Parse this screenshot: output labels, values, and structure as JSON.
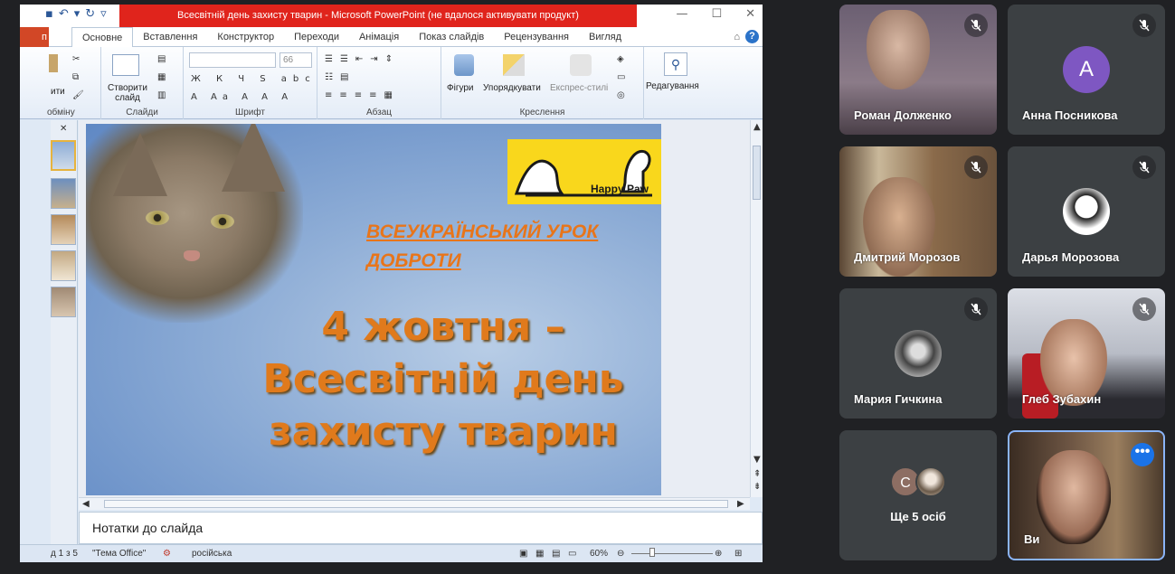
{
  "powerpoint": {
    "window_title": "Всесвітній день захисту тварин  -  Microsoft PowerPoint (не вдалося активувати продукт)",
    "file_tab": "п",
    "tabs": [
      "Основне",
      "Вставлення",
      "Конструктор",
      "Переходи",
      "Анімація",
      "Показ слайдів",
      "Рецензування",
      "Вигляд"
    ],
    "active_tab": "Основне",
    "ribbon": {
      "paste_label": "ити",
      "clipboard_group": "обміну",
      "new_slide_label_1": "Створити",
      "new_slide_label_2": "слайд",
      "slides_group": "Слайди",
      "font_size": "66",
      "font_group": "Шрифт",
      "paragraph_group": "Абзац",
      "shapes_label": "Фігури",
      "arrange_label": "Упорядкувати",
      "quick_styles_label": "Експрес-стилі",
      "drawing_group": "Креслення",
      "editing_label": "Редагування"
    },
    "slide": {
      "logo_text": "Happy Paw",
      "lesson_line1": "ВСЕУКРАЇНСЬКИЙ УРОК",
      "lesson_line2": "ДОБРОТИ",
      "headline_line1": "4 жовтня –",
      "headline_line2": "Всесвітній день",
      "headline_line3": "захисту тварин"
    },
    "notes_placeholder": "Нотатки до слайда",
    "status": {
      "slide_counter": "д 1 з 5",
      "theme": "\"Тема Office\"",
      "language": "російська",
      "zoom": "60%"
    },
    "colors": {
      "title_bar": "#e0241c",
      "headline": "#e07a1c",
      "logo_bg": "#f9d71c"
    }
  },
  "participants": [
    {
      "name": "Роман Долженко",
      "muted": true,
      "kind": "video"
    },
    {
      "name": "Анна Посникова",
      "muted": true,
      "kind": "letter",
      "letter": "А"
    },
    {
      "name": "Дмитрий Морозов",
      "muted": true,
      "kind": "video"
    },
    {
      "name": "Дарья Морозова",
      "muted": true,
      "kind": "photo"
    },
    {
      "name": "Мария Гичкина",
      "muted": true,
      "kind": "photo"
    },
    {
      "name": "Глеб Зубахин",
      "muted": true,
      "kind": "video"
    },
    {
      "name": "Ще 5 осіб",
      "kind": "others",
      "letter": "С"
    },
    {
      "name": "Ви",
      "kind": "self",
      "more_icon": "more-options-icon"
    }
  ]
}
